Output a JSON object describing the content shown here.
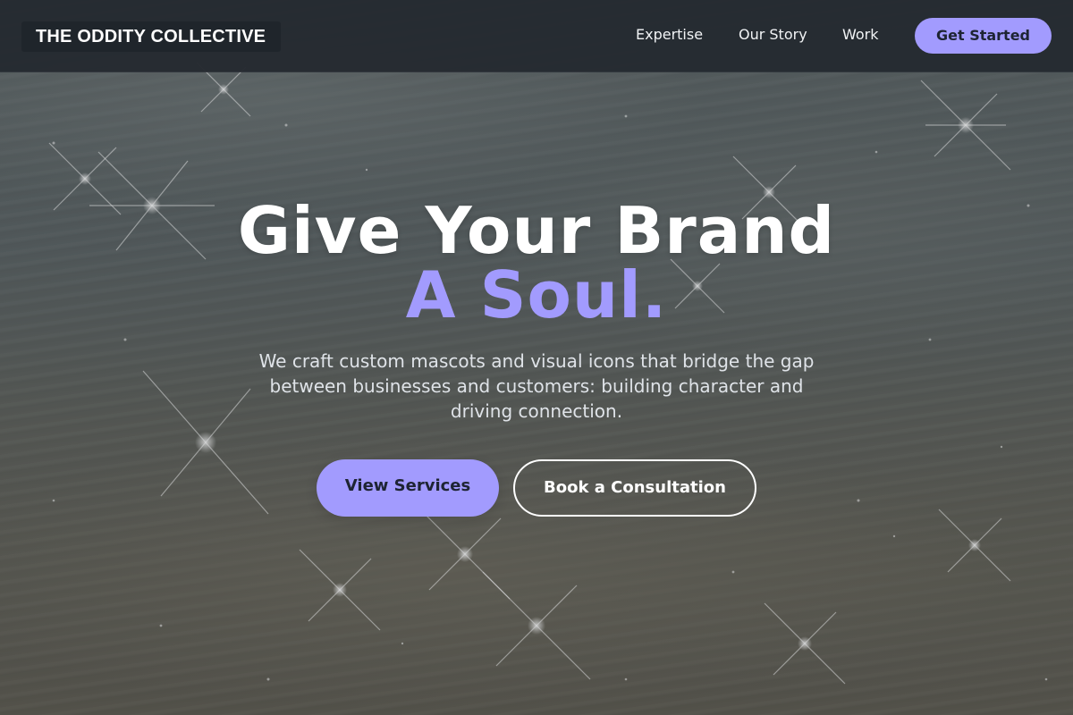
{
  "header": {
    "brand": "THE ODDITY COLLECTIVE",
    "nav": {
      "expertise": "Expertise",
      "story": "Our Story",
      "work": "Work"
    },
    "cta": "Get Started"
  },
  "hero": {
    "title_line1": "Give Your Brand",
    "title_line2": "A Soul.",
    "subtitle": "We craft custom mascots and visual icons that bridge the gap between businesses and customers: building character and driving connection.",
    "primary_button": "View Services",
    "secondary_button": "Book a Consultation",
    "background_image": "sparkling-water-image"
  },
  "colors": {
    "accent": "#a29bfe",
    "header_bg": "#252a31",
    "button_text": "#1e2433"
  }
}
